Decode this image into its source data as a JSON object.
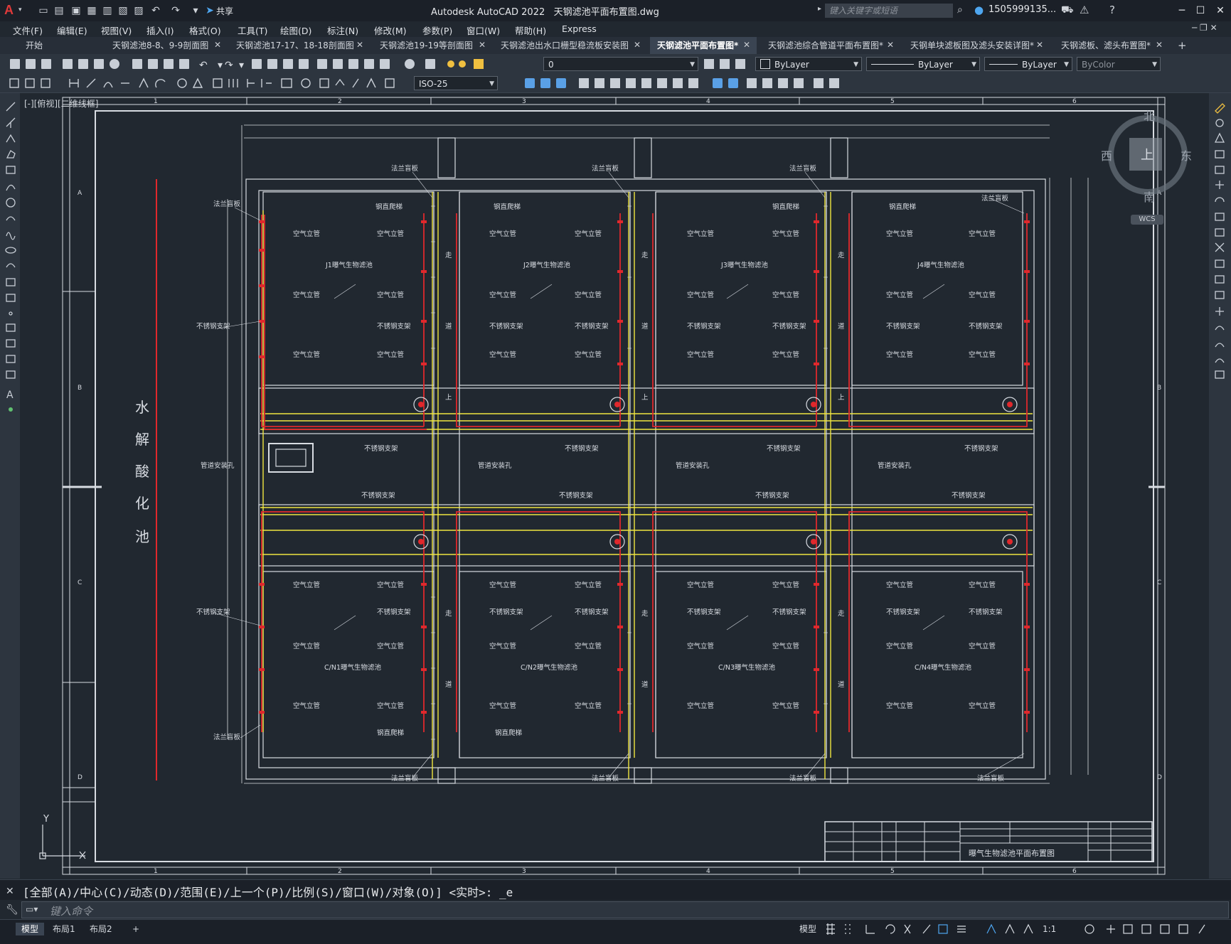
{
  "app": {
    "title": "Autodesk AutoCAD 2022",
    "file": "天钢滤池平面布置图.dwg",
    "share": "共享",
    "search_placeholder": "键入关键字或短语",
    "user": "1505999135..."
  },
  "menu": [
    "文件(F)",
    "编辑(E)",
    "视图(V)",
    "插入(I)",
    "格式(O)",
    "工具(T)",
    "绘图(D)",
    "标注(N)",
    "修改(M)",
    "参数(P)",
    "窗口(W)",
    "帮助(H)",
    "Express"
  ],
  "tabs": [
    {
      "label": "开始"
    },
    {
      "label": "天钢滤池8-8、9-9剖面图"
    },
    {
      "label": "天钢滤池17-17、18-18剖面图"
    },
    {
      "label": "天钢滤池19-19等剖面图"
    },
    {
      "label": "天钢滤池出水口栅型稳流板安装图"
    },
    {
      "label": "天钢滤池平面布置图*"
    },
    {
      "label": "天钢滤池综合管道平面布置图*"
    },
    {
      "label": "天钢单块滤板图及滤头安装详图*"
    },
    {
      "label": "天钢滤板、滤头布置图*"
    }
  ],
  "toolbar": {
    "layer": "0",
    "color": "ByLayer",
    "linetype": "ByLayer",
    "lineweight": "ByLayer",
    "plotstyle": "ByColor",
    "dimstyle": "ISO-25"
  },
  "viewport": {
    "label": "[-][俯视][二维线框]"
  },
  "viewcube": {
    "n": "北",
    "s": "南",
    "w": "西",
    "e": "东",
    "top": "上",
    "wcs": "WCS"
  },
  "drawing": {
    "side_label_chars": [
      "水",
      "解",
      "酸",
      "化",
      "池"
    ],
    "labels": {
      "air_pipe": "空气立管",
      "steel_support": "不锈钢支架",
      "flange": "法兰盲板",
      "ladder": "钢直爬梯",
      "pipe_hole": "管道安装孔",
      "walkway": "走",
      "walkway2": "道",
      "up": "上"
    },
    "cells_top": [
      "J1曝气生物滤池",
      "J2曝气生物滤池",
      "J3曝气生物滤池",
      "J4曝气生物滤池"
    ],
    "cells_bottom": [
      "C/N1曝气生物滤池",
      "C/N2曝气生物滤池",
      "C/N3曝气生物滤池",
      "C/N4曝气生物滤池"
    ],
    "title_block": "曝气生物滤池平面布置图",
    "grid_numbers": [
      "1",
      "2",
      "3",
      "4",
      "5",
      "6"
    ],
    "grid_letters": [
      "A",
      "B",
      "C",
      "D"
    ]
  },
  "command": {
    "history": "[全部(A)/中心(C)/动态(D)/范围(E)/上一个(P)/比例(S)/窗口(W)/对象(O)] <实时>: _e",
    "placeholder": "键入命令"
  },
  "layout_tabs": [
    "模型",
    "布局1",
    "布局2"
  ],
  "status": {
    "model": "模型",
    "scale": "1:1"
  },
  "colors": {
    "yellow": "#f0e640",
    "red": "#e0282c",
    "white": "#d8dce2",
    "bg": "#212830"
  }
}
